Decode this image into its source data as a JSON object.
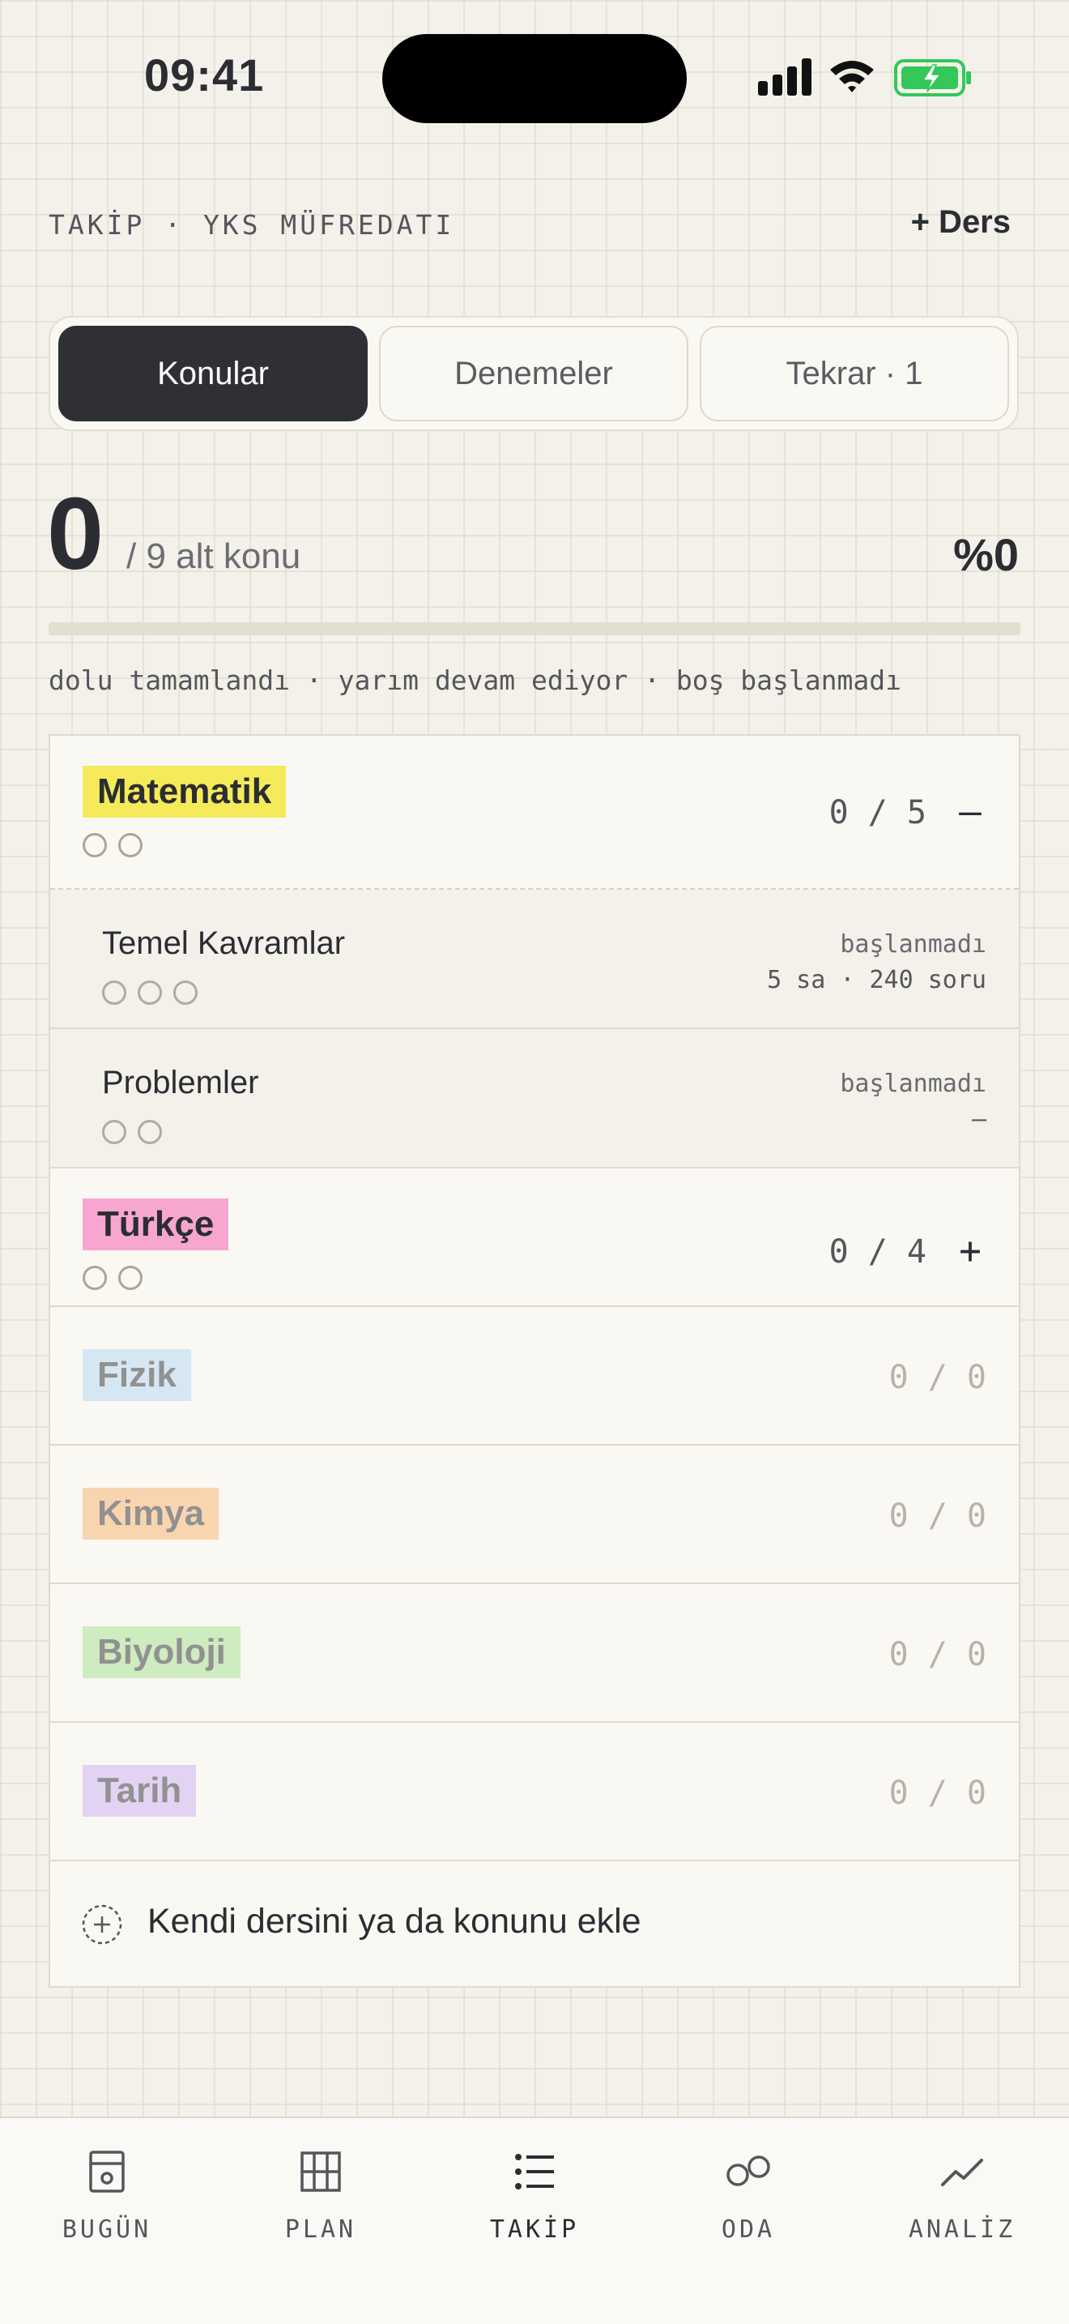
{
  "status_bar": {
    "time": "09:41"
  },
  "header": {
    "eyebrow": "TAKİP · YKS MÜFREDATI",
    "add_subject": "+ Ders"
  },
  "tabs": [
    {
      "label": "Konular",
      "active": true
    },
    {
      "label": "Denemeler",
      "active": false
    },
    {
      "label": "Tekrar · 1",
      "active": false
    }
  ],
  "progress": {
    "count": "0",
    "label": "/ 9 alt konu",
    "percent_text": "%0",
    "fraction": 0
  },
  "legend": "dolu tamamlandı · yarım devam ediyor · boş başlanmadı",
  "subjects": [
    {
      "name": "Matematik",
      "count": "0 / 5",
      "toggle": "—",
      "color": "#f5ea5a"
    },
    {
      "name": "Türkçe",
      "count": "0 / 4",
      "toggle": "+",
      "color": "#f7a6cf"
    },
    {
      "name": "Fizik",
      "count": "0 / 0",
      "color": "#b3d7f5"
    },
    {
      "name": "Kimya",
      "count": "0 / 0",
      "color": "#f9b36e"
    },
    {
      "name": "Biyoloji",
      "count": "0 / 0",
      "color": "#a5e08f"
    },
    {
      "name": "Tarih",
      "count": "0 / 0",
      "color": "#cdb0f3"
    }
  ],
  "topics": [
    {
      "name": "Temel Kavramlar",
      "status": "başlanmadı",
      "meta": "5 sa · 240 soru"
    },
    {
      "name": "Problemler",
      "status": "başlanmadı",
      "meta": "—"
    }
  ],
  "add_custom": "Kendi dersini ya da konunu ekle",
  "nav": [
    {
      "label": "BUGÜN",
      "icon": "today-icon"
    },
    {
      "label": "PLAN",
      "icon": "grid-icon"
    },
    {
      "label": "TAKİP",
      "icon": "list-icon",
      "active": true
    },
    {
      "label": "ODA",
      "icon": "room-icon"
    },
    {
      "label": "ANALİZ",
      "icon": "trend-icon"
    }
  ]
}
